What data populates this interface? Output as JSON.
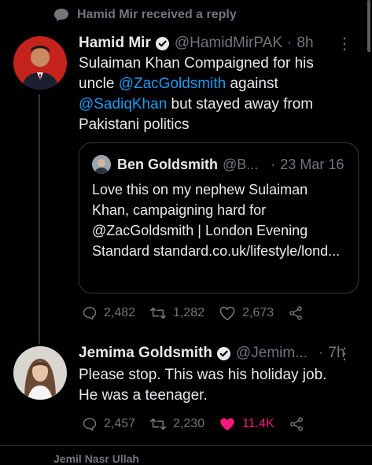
{
  "context": {
    "text": "Hamid Mir received a reply",
    "icon": "chat-bubble-icon"
  },
  "tweet1": {
    "name": "Hamid Mir",
    "handle": "@HamidMirPAK",
    "sep": "·",
    "time": "8h",
    "body": {
      "t1": "Sulaiman Khan Compaigned for his uncle ",
      "m1": "@ZacGoldsmith",
      "t2": " against ",
      "m2": "@SadiqKhan",
      "t3": " but stayed away from Pakistani politics"
    },
    "quote": {
      "name": "Ben Goldsmith",
      "handle": "@B...",
      "sep": "·",
      "date": "23 Mar 16",
      "text": "Love this on my nephew Sulaiman Khan, campaigning hard for @ZacGoldsmith | London Evening Standard standard.co.uk/lifestyle/lond..."
    },
    "stats": {
      "replies": "2,482",
      "retweets": "1,282",
      "likes": "2,673"
    }
  },
  "tweet2": {
    "name": "Jemima Goldsmith",
    "handle": "@Jemim...",
    "sep": "·",
    "time": "7h",
    "body": "Please stop. This was his holiday job. He was a teenager.",
    "stats": {
      "replies": "2,457",
      "retweets": "2,230",
      "likes": "11.4K",
      "liked": true
    }
  },
  "next_row": "Jemil Nasr Ullah",
  "colors": {
    "accent": "#1d9bf0",
    "like": "#f91880",
    "bg": "#000000",
    "muted": "#71767b"
  }
}
